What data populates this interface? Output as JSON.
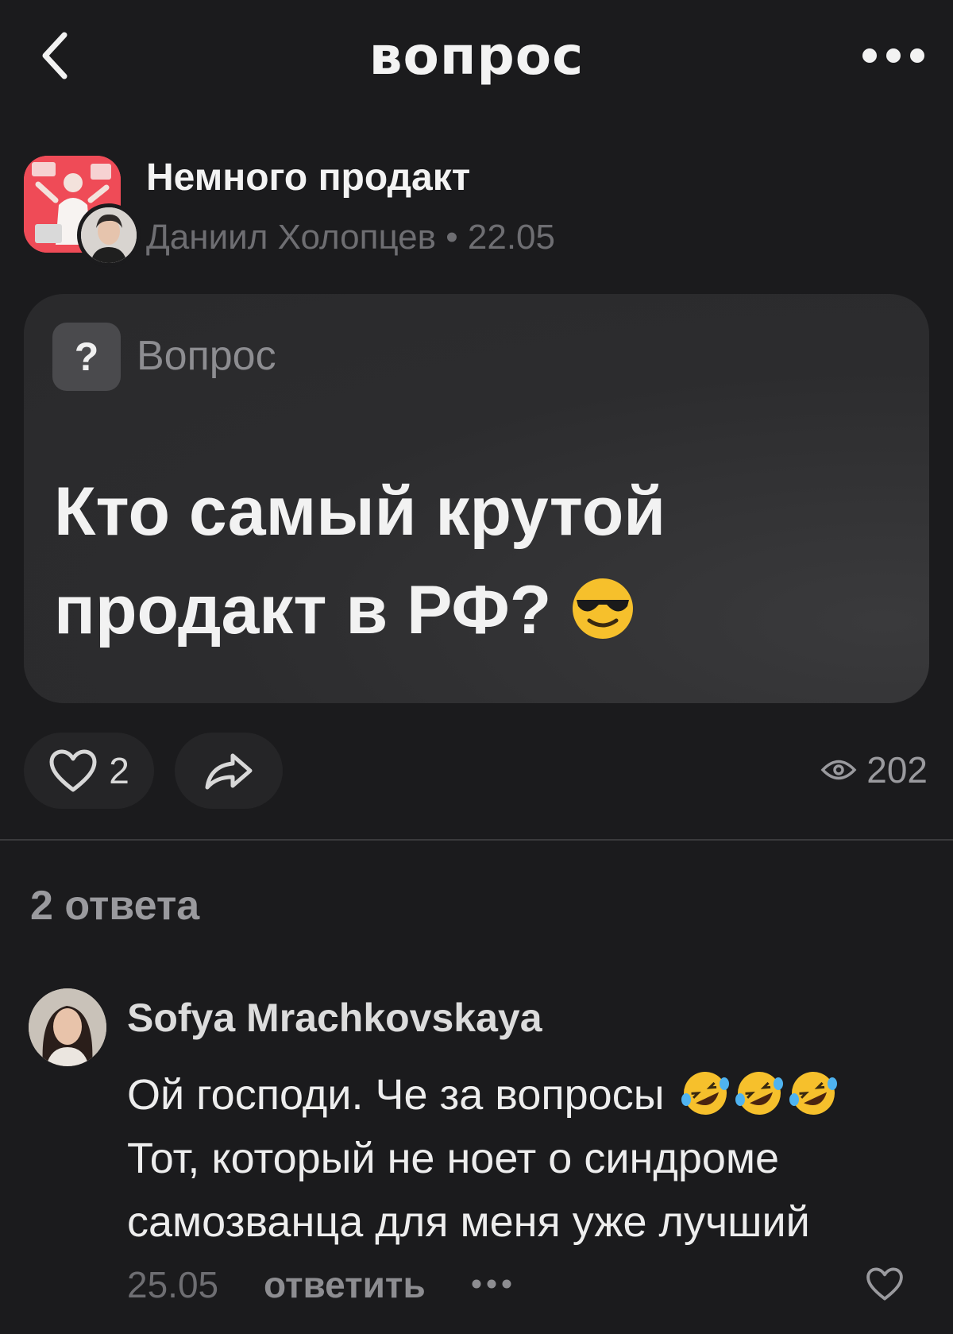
{
  "header": {
    "title": "вопрос",
    "back_icon": "chevron-left-icon",
    "more_icon": "more-horizontal-icon"
  },
  "post": {
    "community_name": "Немного продакт",
    "author_name": "Даниил Холопцев",
    "separator": "•",
    "date": "22.05",
    "question_label": "Вопрос",
    "question_badge": "?",
    "question_text": "Кто самый крутой продакт в РФ?",
    "question_emoji": "smiling-face-with-sunglasses",
    "likes": "2",
    "views": "202"
  },
  "answers": {
    "heading": "2 ответа",
    "items": [
      {
        "author": "Sofya Mrachkovskaya",
        "text_line_1": "Ой господи. Че за вопросы",
        "text_line_2": "Тот, который не ноет о синдроме",
        "text_line_3": "самозванца для меня уже лучший",
        "line_1_emojis": [
          "rolling-on-the-floor-laughing",
          "rolling-on-the-floor-laughing",
          "rolling-on-the-floor-laughing"
        ],
        "date": "25.05",
        "reply_label": "ответить"
      }
    ]
  },
  "colors": {
    "background": "#1b1b1d",
    "card": "#2c2c2e",
    "muted_text": "#6e6e72",
    "community_avatar": "#ef4b57"
  }
}
